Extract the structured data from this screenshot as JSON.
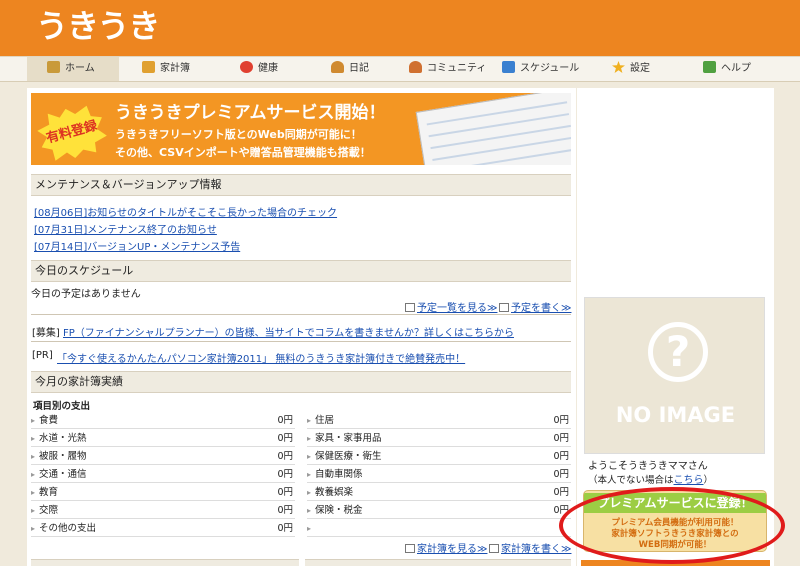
{
  "app": {
    "logo": "うきうき"
  },
  "nav": [
    {
      "label": "ホーム",
      "icon": "home-icon",
      "color": "#c99a3a"
    },
    {
      "label": "家計簿",
      "icon": "pencil-icon",
      "color": "#e0a030"
    },
    {
      "label": "健康",
      "icon": "heart-icon",
      "color": "#e04030"
    },
    {
      "label": "日記",
      "icon": "person-icon",
      "color": "#d08a30"
    },
    {
      "label": "コミュニティ",
      "icon": "people-icon",
      "color": "#d07030"
    },
    {
      "label": "スケジュール",
      "icon": "calendar-icon",
      "color": "#3a80d0"
    },
    {
      "label": "設定",
      "icon": "star-icon",
      "color": "#f0b020"
    },
    {
      "label": "ヘルプ",
      "icon": "help-icon",
      "color": "#50a040"
    }
  ],
  "banner": {
    "badge": "有料登録",
    "title": "うきうきプレミアムサービス開始！",
    "line1": "うきうきフリーソフト版とのWeb同期が可能に！",
    "line2": "その他、CSVインポートや贈答品管理機能も搭載！"
  },
  "maintenance": {
    "heading": "メンテナンス＆バージョンアップ情報",
    "items": [
      "[08月06日]お知らせのタイトルがそこそこ長かった場合のチェック",
      "[07月31日]メンテナンス終了のお知らせ",
      "[07月14日]バージョンUP・メンテナンス予告"
    ]
  },
  "schedule": {
    "heading": "今日のスケジュール",
    "empty": "今日の予定はありません",
    "list_link": "予定一覧を見る≫",
    "write_link": "予定を書く≫"
  },
  "ads": [
    {
      "tag": "[募集]",
      "text": "FP（ファイナンシャルプランナー）の皆様、当サイトでコラムを書きませんか？詳しくはこちらから"
    },
    {
      "tag": "[PR]",
      "text": "「今すぐ使えるかんたんパソコン家計簿2011」 無料のうきうき家計簿付きで絶賛発売中！"
    }
  ],
  "budget": {
    "heading": "今月の家計簿実績",
    "subheading": "項目別の支出",
    "left": [
      {
        "name": "食費",
        "value": "0円"
      },
      {
        "name": "水道・光熱",
        "value": "0円"
      },
      {
        "name": "被服・履物",
        "value": "0円"
      },
      {
        "name": "交通・通信",
        "value": "0円"
      },
      {
        "name": "教育",
        "value": "0円"
      },
      {
        "name": "交際",
        "value": "0円"
      },
      {
        "name": "その他の支出",
        "value": "0円"
      }
    ],
    "right": [
      {
        "name": "住居",
        "value": "0円"
      },
      {
        "name": "家具・家事用品",
        "value": "0円"
      },
      {
        "name": "保健医療・衛生",
        "value": "0円"
      },
      {
        "name": "自動車関係",
        "value": "0円"
      },
      {
        "name": "教養娯楽",
        "value": "0円"
      },
      {
        "name": "保険・税金",
        "value": "0円"
      },
      {
        "name": "",
        "value": ""
      }
    ],
    "view_link": "家計簿を見る≫",
    "write_link": "家計簿を書く≫"
  },
  "sidebar": {
    "noimage": "NO IMAGE",
    "noimage_mark": "?",
    "welcome": "ようこそうきうきママさん",
    "not_you_prefix": "（本人でない場合は",
    "not_you_link": "こちら",
    "not_you_suffix": "）",
    "premium_title": "プレミアムサービスに登録！",
    "premium_lines": [
      "プレミアム会員機能が利用可能！",
      "家計簿ソフトうきうき家計簿との",
      "WEB同期が可能！"
    ]
  },
  "colors": {
    "brand": "#ed8520",
    "link": "#1a4fb0",
    "highlight": "#e01b1b",
    "premium_green": "#9ccd44"
  }
}
